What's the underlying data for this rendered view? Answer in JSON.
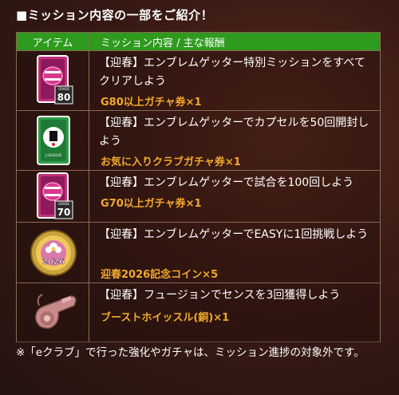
{
  "heading": "■ミッション内容の一部をご紹介！",
  "table": {
    "col_item": "アイテム",
    "col_mission": "ミッション内容 / 主な報酬",
    "rows": [
      {
        "icon": "ticket-pink-80-icon",
        "badge": "80",
        "grade": "GRADE",
        "mission": "【迎春】エンブレムゲッター特別ミッションをすべてクリアしよう",
        "reward": "G80以上ガチャ券×1"
      },
      {
        "icon": "ticket-green-jleague-icon",
        "badge_text": "J.LEAGUE",
        "mission": "【迎春】エンブレムゲッターでカプセルを50回開封しよう",
        "reward": "お気に入りクラブガチャ券×1"
      },
      {
        "icon": "ticket-pink-70-icon",
        "badge": "70",
        "grade": "GRADE",
        "mission": "【迎春】エンブレムゲッターで試合を100回しよう",
        "reward": "G70以上ガチャ券×1"
      },
      {
        "icon": "coin-2026-icon",
        "coin_text": "2026",
        "mission": "【迎春】エンブレムゲッターでEASYに1回挑戦しよう",
        "reward": "迎春2026記念コイン×5"
      },
      {
        "icon": "whistle-icon",
        "mission": "【迎春】フュージョンでセンスを3回獲得しよう",
        "reward": "ブーストホイッスル(銅)×1"
      }
    ]
  },
  "note": "※「eクラブ」で行った強化やガチャは、ミッション進捗の対象外です。",
  "colors": {
    "header_green": "#2e9a1e",
    "reward_orange": "#f2a92c",
    "border": "#8a6a55"
  }
}
